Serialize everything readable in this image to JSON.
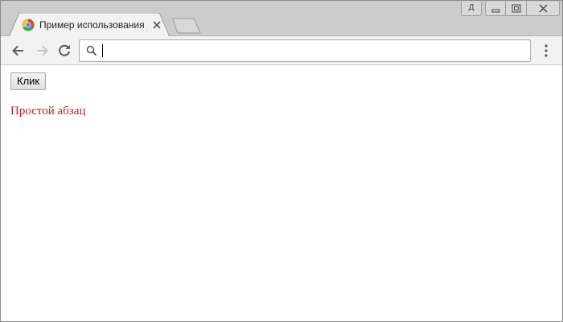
{
  "tab": {
    "title": "Пример использования jQuery",
    "favicon": "chromium-favicon"
  },
  "window_controls": {
    "profile_label": "Д",
    "icons": [
      "minimize-icon",
      "maximize-icon",
      "close-icon"
    ]
  },
  "toolbar": {
    "back_icon": "arrow-left-icon",
    "forward_icon": "arrow-right-icon",
    "reload_icon": "reload-icon",
    "omnibox_value": "",
    "search_icon": "search-icon",
    "menu_icon": "kebab-menu-icon"
  },
  "page": {
    "button_label": "Клик",
    "paragraph_text": "Простой абзац",
    "paragraph_color": "#b22222"
  }
}
